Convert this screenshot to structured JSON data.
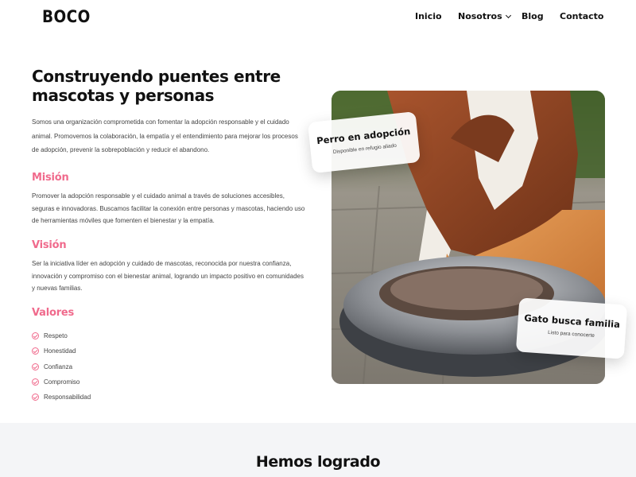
{
  "brand": {
    "logo": "BOCO"
  },
  "nav": {
    "items": [
      {
        "label": "Inicio"
      },
      {
        "label": "Nosotros"
      },
      {
        "label": "Blog"
      },
      {
        "label": "Contacto"
      }
    ]
  },
  "hero": {
    "title": "Construyendo puentes entre mascotas y personas",
    "intro": "Somos una organización comprometida con fomentar la adopción responsable y el cuidado animal. Promovemos la colaboración, la empatía y el entendimiento para mejorar los procesos de adopción, prevenir la sobrepoblación y reducir el abandono."
  },
  "mission": {
    "title": "Misión",
    "text": "Promover la adopción responsable y el cuidado animal a través de soluciones accesibles, seguras e innovadoras. Buscamos facilitar la conexión entre personas y mascotas, haciendo uso de herramientas móviles que fomenten el bienestar y la empatía."
  },
  "vision": {
    "title": "Visión",
    "text": "Ser la iniciativa líder en adopción y cuidado de mascotas, reconocida por nuestra confianza, innovación y compromiso con el bienestar animal, logrando un impacto positivo en comunidades y nuevas familias."
  },
  "values": {
    "title": "Valores",
    "items": [
      "Respeto",
      "Honestidad",
      "Confianza",
      "Compromiso",
      "Responsabilidad"
    ]
  },
  "cards": {
    "dog": {
      "title": "Perro en adopción",
      "subtitle": "Disponible en refugio aliado"
    },
    "cat": {
      "title": "Gato busca familia",
      "subtitle": "Listo para conocerte"
    }
  },
  "achievements": {
    "title": "Hemos logrado"
  },
  "colors": {
    "accent": "#f06a8c",
    "text": "#111111",
    "band": "#f4f5f7"
  }
}
